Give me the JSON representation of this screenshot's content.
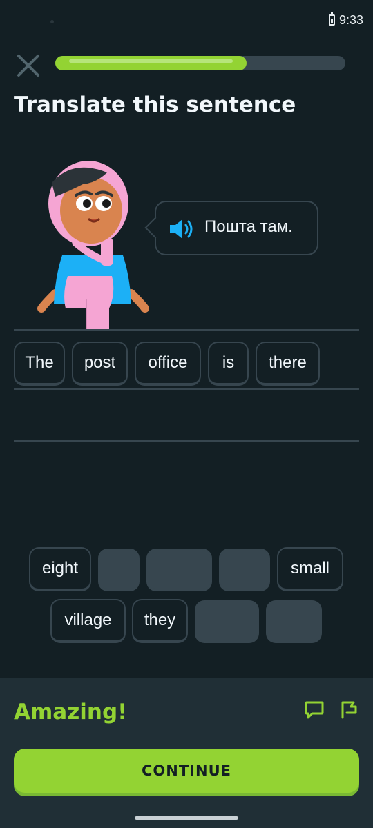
{
  "status_bar": {
    "time": "9:33"
  },
  "lesson": {
    "progress_fraction": 0.66,
    "title": "Translate this sentence"
  },
  "prompt": {
    "text": "Пошта там.",
    "speaker_icon": "speaker-icon"
  },
  "answer": {
    "words": [
      "The",
      "post",
      "office",
      "is",
      "there"
    ]
  },
  "word_bank": {
    "row1": [
      "eight",
      "",
      "",
      "",
      "small"
    ],
    "row2": [
      "village",
      "they",
      "",
      ""
    ]
  },
  "feedback": {
    "message": "Amazing!",
    "discuss_icon": "comment-icon",
    "report_icon": "flag-icon",
    "continue_label": "CONTINUE"
  },
  "colors": {
    "background": "#131f24",
    "accent_green": "#93d333",
    "border": "#37464f",
    "footer": "#202f36",
    "blue": "#1cb0f6",
    "pink": "#f5a5d3"
  }
}
